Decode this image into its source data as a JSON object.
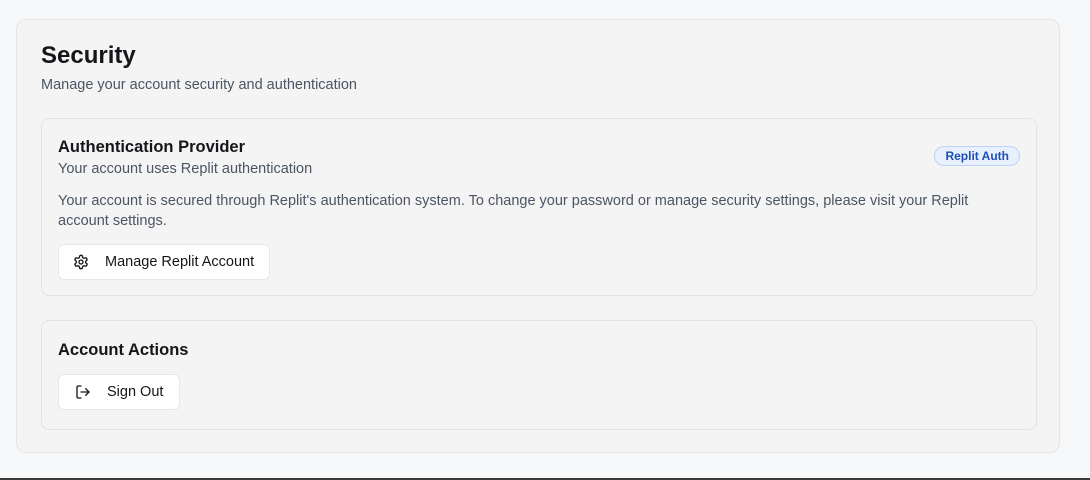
{
  "header": {
    "title": "Security",
    "subtitle": "Manage your account security and authentication"
  },
  "auth_provider": {
    "title": "Authentication Provider",
    "description": "Your account uses Replit authentication",
    "badge": "Replit Auth",
    "badge_color": "#1e4fb8",
    "body": "Your account is secured through Replit's authentication system. To change your password or manage security settings, please visit your Replit account settings.",
    "button_label": "Manage Replit Account",
    "button_icon": "gear-icon"
  },
  "account_actions": {
    "title": "Account Actions",
    "button_label": "Sign Out",
    "button_icon": "log-out-icon"
  }
}
